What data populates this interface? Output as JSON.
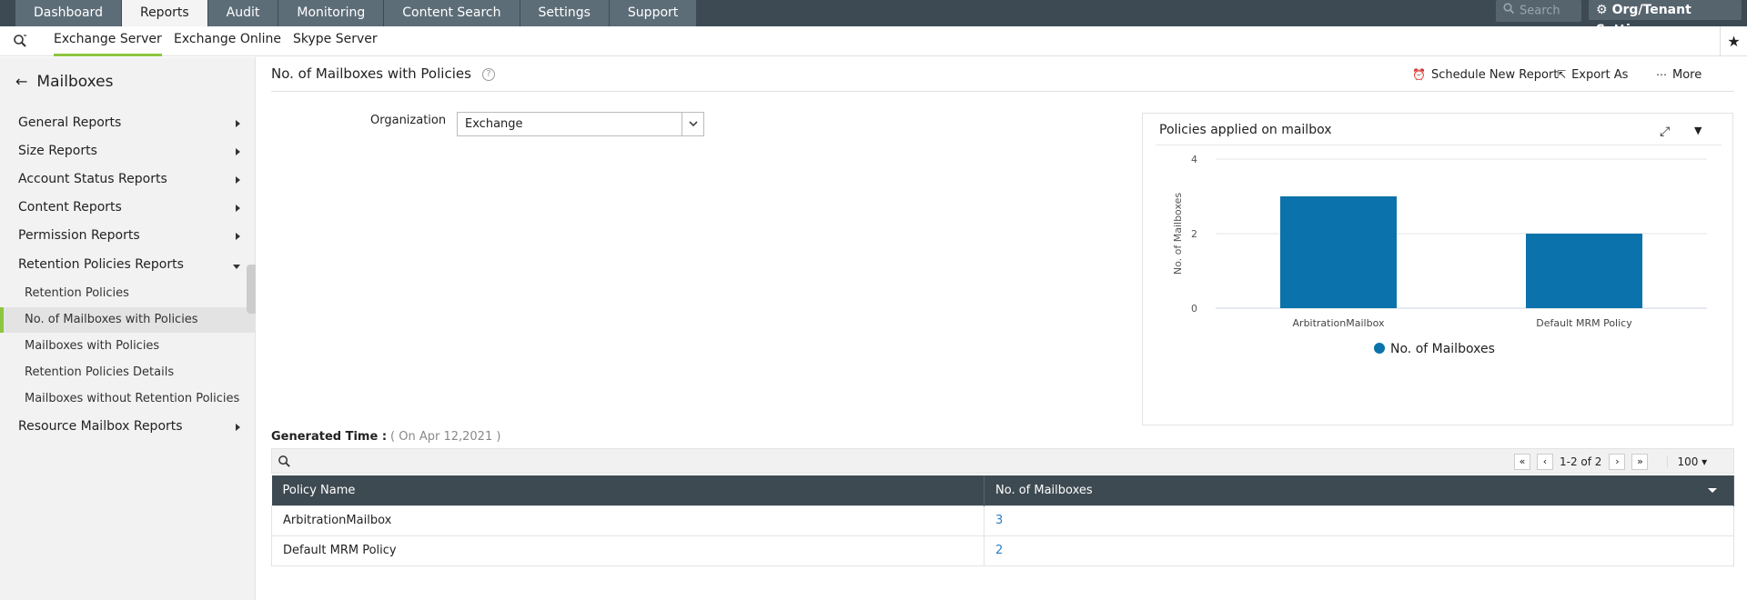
{
  "topnav": {
    "tabs": [
      "Dashboard",
      "Reports",
      "Audit",
      "Monitoring",
      "Content Search",
      "Settings",
      "Support"
    ],
    "active_tab": "Reports",
    "search_placeholder": "Search",
    "org_settings_label": "Org/Tenant Settings"
  },
  "subnav": {
    "tabs": [
      "Exchange Server",
      "Exchange Online",
      "Skype Server"
    ],
    "active_tab": "Exchange Server"
  },
  "sidebar": {
    "heading": "Mailboxes",
    "groups": [
      {
        "label": "General Reports"
      },
      {
        "label": "Size Reports"
      },
      {
        "label": "Account Status Reports"
      },
      {
        "label": "Content Reports"
      },
      {
        "label": "Permission Reports"
      },
      {
        "label": "Retention Policies Reports"
      },
      {
        "label": "Resource Mailbox Reports"
      }
    ],
    "items": [
      {
        "label": "Retention Policies"
      },
      {
        "label": "No. of Mailboxes with Policies"
      },
      {
        "label": "Mailboxes with Policies"
      },
      {
        "label": "Retention Policies Details"
      },
      {
        "label": "Mailboxes without Retention Policies"
      }
    ],
    "active_item": "No. of Mailboxes with Policies"
  },
  "main": {
    "title": "No. of Mailboxes with Policies",
    "help_glyph": "?",
    "actions": {
      "schedule": "Schedule New Report",
      "export": "Export As",
      "more": "More"
    },
    "org_label": "Organization",
    "org_value": "Exchange",
    "generated_label": "Generated Time :",
    "generated_value": "( On Apr 12,2021 )"
  },
  "chart_data": {
    "type": "bar",
    "title": "Policies applied on mailbox",
    "categories": [
      "ArbitrationMailbox",
      "Default MRM Policy"
    ],
    "series": [
      {
        "name": "No. of Mailboxes",
        "values": [
          3,
          2
        ],
        "color": "#0b72ab"
      }
    ],
    "ylabel": "No. of Mailboxes",
    "xlabel": "",
    "ylim": [
      0,
      4
    ],
    "yticks": [
      0,
      2,
      4
    ],
    "grid": true,
    "legend": "bottom-center"
  },
  "table": {
    "pager_text": "1-2 of 2",
    "page_size": "100",
    "columns": [
      "Policy Name",
      "No. of Mailboxes"
    ],
    "rows": [
      [
        "ArbitrationMailbox",
        "3"
      ],
      [
        "Default MRM Policy",
        "2"
      ]
    ]
  }
}
